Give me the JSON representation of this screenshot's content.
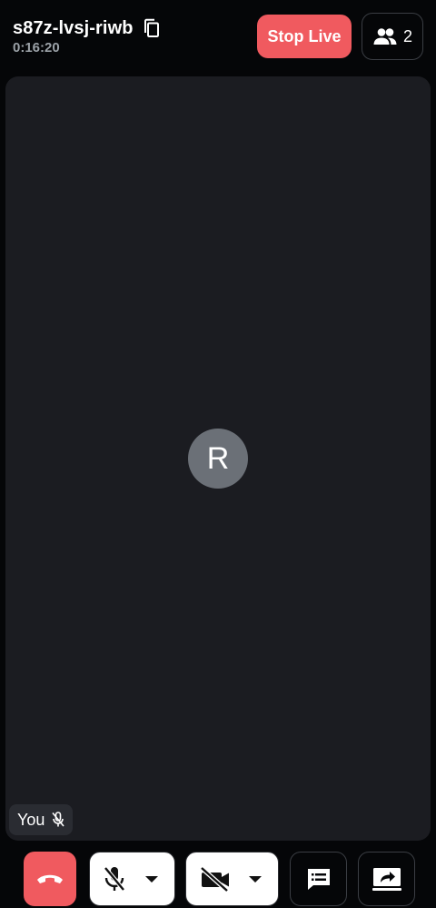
{
  "header": {
    "meeting_id": "s87z-lvsj-riwb",
    "duration": "0:16:20",
    "stop_live_label": "Stop Live",
    "participant_count": "2"
  },
  "tile": {
    "avatar_initial": "R",
    "name_label": "You",
    "mic_state": "muted"
  },
  "controls": {
    "mic": "muted",
    "camera": "off"
  },
  "icons": {
    "copy": "copy-icon",
    "participants": "people-icon",
    "end_call": "phone-hangup-icon",
    "mic": "mic-off-icon",
    "camera": "camera-off-icon",
    "chat": "chat-icon",
    "share": "screen-share-icon"
  },
  "colors": {
    "accent_red": "#f05a5f",
    "background": "#050608",
    "tile": "#1b1c21",
    "avatar": "#6b7077"
  }
}
